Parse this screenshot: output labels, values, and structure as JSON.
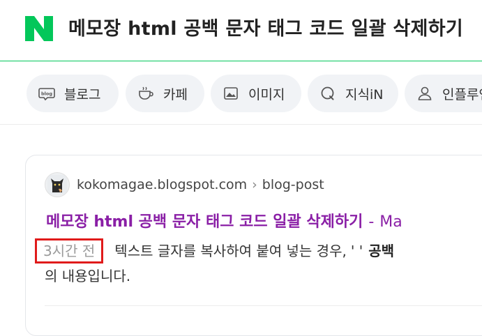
{
  "header": {
    "logo_letter": "N",
    "search_query": "메모장 html 공백 문자 태그 코드 일괄 삭제하기"
  },
  "tabs": [
    {
      "label": "블로그",
      "icon": "blog-icon"
    },
    {
      "label": "카페",
      "icon": "cafe-cup-icon"
    },
    {
      "label": "이미지",
      "icon": "image-icon"
    },
    {
      "label": "지식iN",
      "icon": "kin-q-icon"
    },
    {
      "label": "인플루언서",
      "icon": "person-icon"
    }
  ],
  "result": {
    "source_site": "kokomagae.blogspot.com",
    "source_sep": "›",
    "source_path": "blog-post",
    "title": "메모장 html 공백 문자 태그 코드 일괄 삭제하기",
    "title_dash": "-",
    "title_site": "Ma",
    "time_ago": "3시간 전",
    "snippet_text": "텍스트 글자를 복사하여 붙여 넣는 경우,",
    "snippet_quote": "' '",
    "snippet_bold": "공백",
    "snippet_line2": "의 내용입니다."
  },
  "colors": {
    "brand_green": "#03c75a",
    "visited_title": "#8a1fa6",
    "highlight_box": "#e01b1b"
  }
}
